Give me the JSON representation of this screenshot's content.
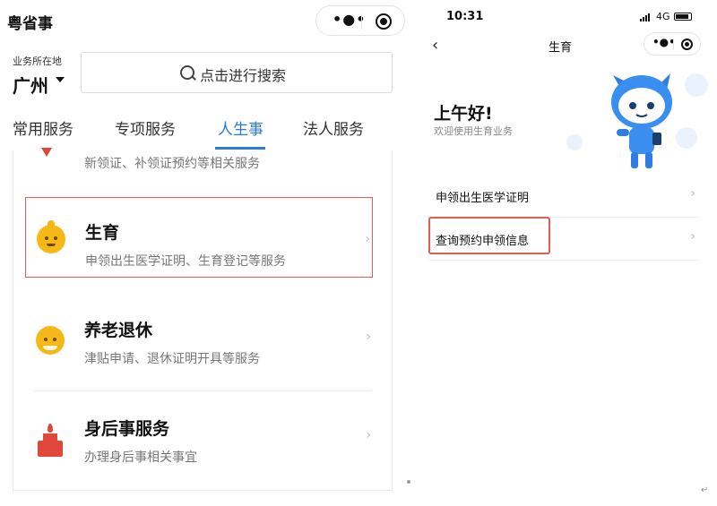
{
  "left_screen": {
    "app_title": "粤省事",
    "capsule": {
      "more_icon": "more-dots-icon",
      "close_icon": "target-icon"
    },
    "location": {
      "label": "业务所在地",
      "value": "广州"
    },
    "search": {
      "placeholder": "点击进行搜索",
      "icon": "search-icon"
    },
    "tabs": [
      {
        "label": "常用服务",
        "active": false
      },
      {
        "label": "专项服务",
        "active": false
      },
      {
        "label": "人生事",
        "active": true
      },
      {
        "label": "法人服务",
        "active": false
      }
    ],
    "partial_item": {
      "subtitle": "新领证、补领证预约等相关服务"
    },
    "services": [
      {
        "title": "生育",
        "subtitle": "申领出生医学证明、生育登记等服务",
        "icon": "baby-face-icon",
        "highlighted": true
      },
      {
        "title": "养老退休",
        "subtitle": "津贴申请、退休证明开具等服务",
        "icon": "elder-face-icon",
        "highlighted": false
      },
      {
        "title": "身后事服务",
        "subtitle": "办理身后事相关事宜",
        "icon": "candle-icon",
        "highlighted": false
      }
    ],
    "accent_color": "#2a7be0",
    "highlight_color": "#e25b55"
  },
  "right_screen": {
    "status_bar": {
      "time": "10:31",
      "network": "4G"
    },
    "nav": {
      "title": "生育",
      "back_icon": "chevron-left-icon"
    },
    "greeting": {
      "title": "上午好!",
      "subtitle": "欢迎使用生育业务"
    },
    "mascot_icon": "robot-mascot-icon",
    "menu": [
      {
        "label": "申领出生医学证明",
        "highlighted": false
      },
      {
        "label": "查询预约申领信息",
        "highlighted": true
      }
    ]
  }
}
